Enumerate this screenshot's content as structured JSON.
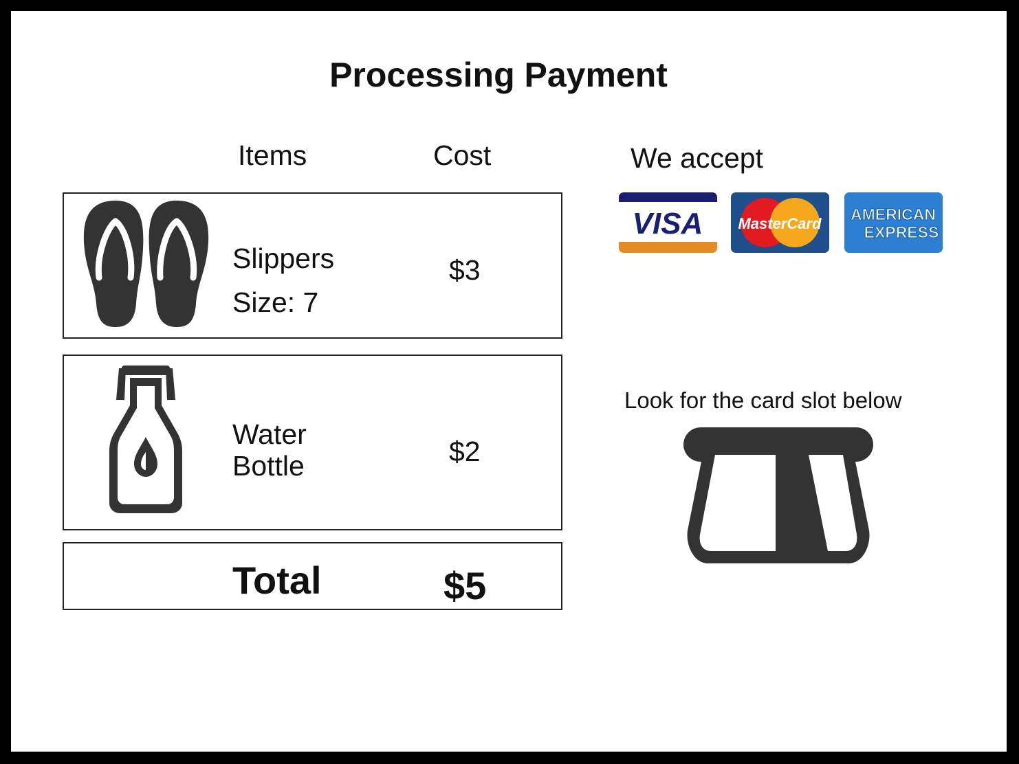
{
  "title": "Processing Payment",
  "order": {
    "headers": {
      "items": "Items",
      "cost": "Cost"
    },
    "items": [
      {
        "name": "Slippers",
        "detail": "Size: 7",
        "cost": "$3",
        "icon": "flip-flops-icon"
      },
      {
        "name_line1": "Water",
        "name_line2": "Bottle",
        "cost": "$2",
        "icon": "water-bottle-icon"
      }
    ],
    "total": {
      "label": "Total",
      "value": "$5"
    }
  },
  "payment": {
    "accept_label": "We accept",
    "card_logos": [
      {
        "name": "visa-logo",
        "text": "VISA"
      },
      {
        "name": "mastercard-logo",
        "text": "MasterCard"
      },
      {
        "name": "amex-logo",
        "text_line1": "AMERICAN",
        "text_line2": "EXPRESS"
      }
    ],
    "instruction": "Look for the card slot below",
    "slot_icon": "card-slot-icon"
  },
  "colors": {
    "icon": "#333333",
    "visa_blue": "#1a1f71",
    "visa_orange": "#e48b22",
    "mastercard_bg": "#1f4e8c",
    "mastercard_red": "#e21a22",
    "mastercard_yellow": "#f5a81c",
    "amex_blue": "#2d7fd1"
  }
}
